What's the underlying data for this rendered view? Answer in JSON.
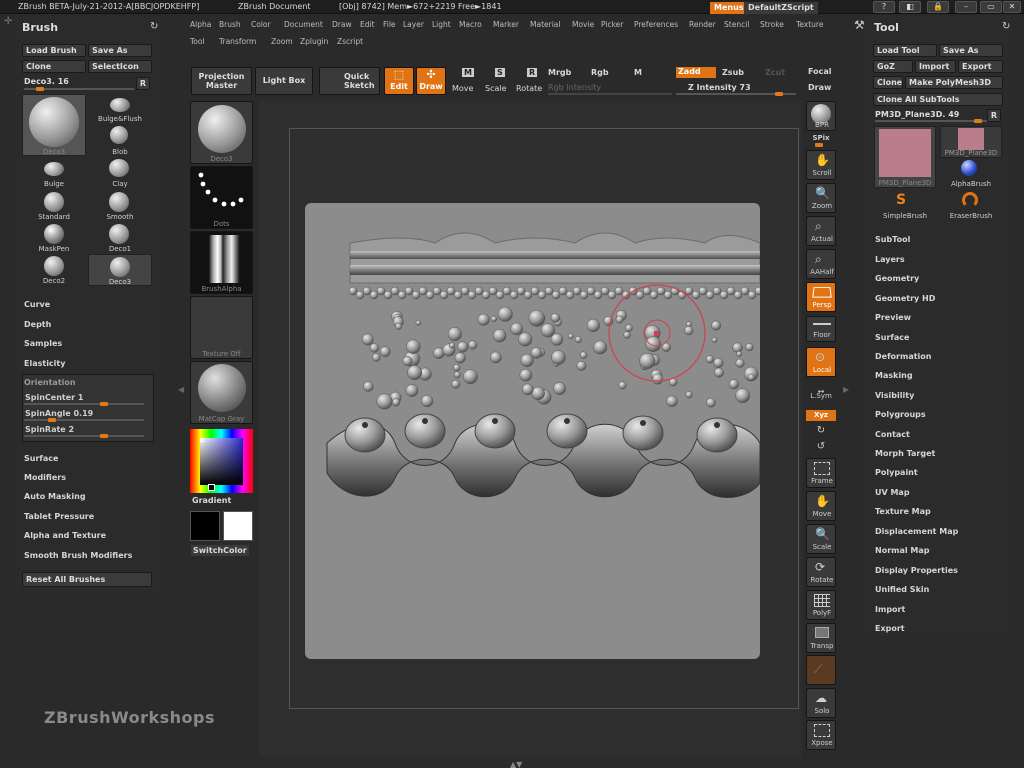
{
  "titlebar": {
    "app": "ZBrush BETA-July-21-2012-A[BBCJOPDKEHFP]",
    "doc": "ZBrush Document",
    "stats": "[Obj] 8742] Mem►672+2219 Free►1841",
    "menus_btn": "Menus",
    "script_btn": "DefaultZScript"
  },
  "menus": [
    "Alpha",
    "Brush",
    "Color",
    "Document",
    "Draw",
    "Edit",
    "File",
    "Layer",
    "Light",
    "Macro",
    "Marker",
    "Material",
    "Movie",
    "Picker",
    "Preferences",
    "Render",
    "Stencil",
    "Stroke",
    "Texture",
    "Tool",
    "Transform",
    "Zoom",
    "Zplugin",
    "Zscript"
  ],
  "brush_panel": {
    "title": "Brush",
    "load_brush": "Load Brush",
    "save_as": "Save As",
    "clone": "Clone",
    "select_icon": "SelectIcon",
    "current": "Deco3. 16",
    "r_btn": "R",
    "large_label": "Deco3",
    "brushes": [
      "Bulge&Flush",
      "Blob",
      "Bulge",
      "Clay",
      "Standard",
      "Smooth",
      "MaskPen",
      "Deco1",
      "Deco2",
      "Deco3"
    ],
    "sections_a": [
      "Curve",
      "Depth",
      "Samples",
      "Elasticity"
    ],
    "orientation": "Orientation",
    "sliders": [
      {
        "label": "SpinCenter 1",
        "level": 0.55
      },
      {
        "label": "SpinAngle 0.19",
        "level": 0.2
      },
      {
        "label": "SpinRate 2",
        "level": 0.55
      }
    ],
    "sections_b": [
      "Surface",
      "Modifiers",
      "Auto Masking",
      "Tablet Pressure",
      "Alpha and Texture",
      "Smooth Brush Modifiers"
    ],
    "reset": "Reset All Brushes"
  },
  "toolbar": {
    "projection_master": "Projection Master",
    "light_box": "Light Box",
    "quick_sketch": "Quick Sketch",
    "edit": "Edit",
    "draw": "Draw",
    "move": "Move",
    "scale": "Scale",
    "rotate": "Rotate",
    "mrgb": "Mrgb",
    "rgb": "Rgb",
    "m": "M",
    "rgb_intensity": "Rgb Intensity",
    "zadd": "Zadd",
    "zsub": "Zsub",
    "zcut": "Zcut",
    "z_intensity": "Z Intensity 73",
    "focal": "Focal",
    "draw_size": "Draw"
  },
  "left_shelf": {
    "brush_lbl": "Deco3",
    "stroke_lbl": "Dots",
    "alpha_lbl": "BrushAlpha",
    "texture_lbl": "Texture Off",
    "material_lbl": "MatCap Gray",
    "gradient": "Gradient",
    "switch_color": "SwitchColor"
  },
  "right_shelf": [
    "BPR",
    "SPix",
    "Scroll",
    "Zoom",
    "Actual",
    "AAHalf",
    "Persp",
    "Floor",
    "Local",
    "L.Sym",
    "Xyz",
    "Frame",
    "Move",
    "Scale",
    "Rotate",
    "PolyF",
    "Transp",
    "Solo",
    "Xpose"
  ],
  "tool_panel": {
    "title": "Tool",
    "load_tool": "Load Tool",
    "save_as": "Save As",
    "goz": "GoZ",
    "import": "Import",
    "export": "Export",
    "clone": "Clone",
    "make_polymesh": "Make PolyMesh3D",
    "clone_all": "Clone All SubTools",
    "current": "PM3D_Plane3D. 49",
    "r_btn": "R",
    "thumb1": "PM3D_Plane3D",
    "thumb2": "PM3D_Plane3D",
    "alphabrush": "AlphaBrush",
    "simplebrush": "SimpleBrush",
    "eraserbrush": "EraserBrush",
    "sections": [
      "SubTool",
      "Layers",
      "Geometry",
      "Geometry HD",
      "Preview",
      "Surface",
      "Deformation",
      "Masking",
      "Visibility",
      "Polygroups",
      "Contact",
      "Morph Target",
      "Polypaint",
      "UV Map",
      "Texture Map",
      "Displacement Map",
      "Normal Map",
      "Display Properties",
      "Unified Skin",
      "Import",
      "Export"
    ]
  },
  "watermark": "ZBrushWorkshops",
  "colors": {
    "accent": "#e07314",
    "panel": "#2b2b2b",
    "plane": "#8c8c8c",
    "cursor_ring": "#d04050"
  }
}
